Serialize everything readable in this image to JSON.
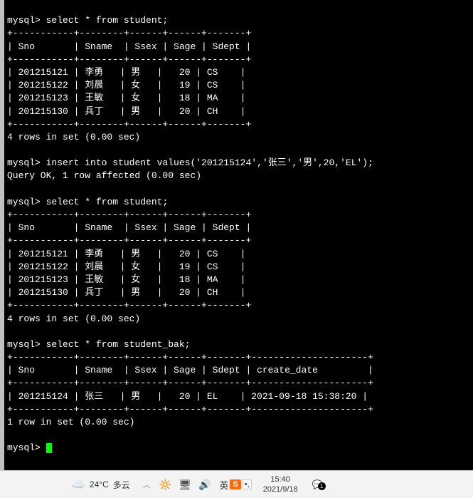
{
  "terminal": {
    "prompt": "mysql>",
    "cmd1": "select * from student;",
    "sep1": "+-----------+--------+------+------+-------+",
    "hdr1": "| Sno       | Sname  | Ssex | Sage | Sdept |",
    "rows1": [
      "| 201215121 | 李勇   | 男   |   20 | CS    |",
      "| 201215122 | 刘晨   | 女   |   19 | CS    |",
      "| 201215123 | 王敏   | 女   |   18 | MA    |",
      "| 201215130 | 兵丁   | 男   |   20 | CH    |"
    ],
    "result1": "4 rows in set (0.00 sec)",
    "cmd2": "insert into student values('201215124','张三','男',20,'EL');",
    "result2": "Query OK, 1 row affected (0.00 sec)",
    "cmd3": "select * from student;",
    "result3": "4 rows in set (0.00 sec)",
    "cmd4": "select * from student_bak;",
    "sep2": "+-----------+--------+------+------+-------+---------------------+",
    "hdr2": "| Sno       | Sname  | Ssex | Sage | Sdept | create_date         |",
    "rows2": [
      "| 201215124 | 张三   | 男   |   20 | EL    | 2021-09-18 15:38:20 |"
    ],
    "result4": "1 row in set (0.00 sec)"
  },
  "taskbar": {
    "weather_temp": "24°C",
    "weather_desc": "多云",
    "ime_lang": "英",
    "ime_brand": "S",
    "ime_punct": "•,",
    "time": "15:40",
    "date": "2021/9/18",
    "notif_count": "1"
  }
}
